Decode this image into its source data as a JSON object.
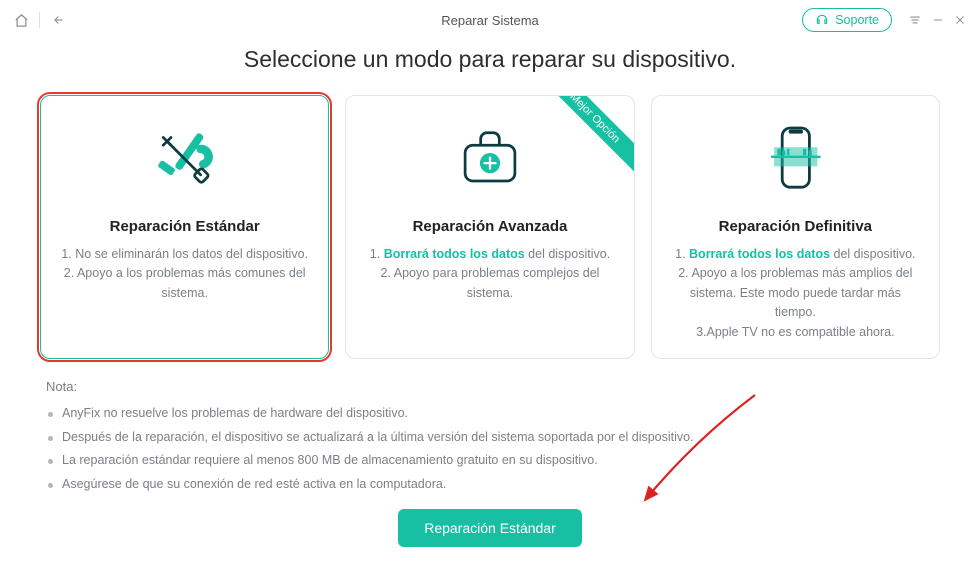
{
  "header": {
    "title": "Reparar Sistema",
    "support_label": "Soporte"
  },
  "page": {
    "heading": "Seleccione un modo para reparar su dispositivo."
  },
  "cards": [
    {
      "title": "Reparación Estándar",
      "line1_pre": "1. ",
      "line1_strong": "",
      "line1_rest": "No se eliminarán los datos del dispositivo.",
      "line2": "2. Apoyo a los problemas más comunes del sistema.",
      "line3": "",
      "ribbon": ""
    },
    {
      "title": "Reparación Avanzada",
      "line1_pre": "1. ",
      "line1_strong": "Borrará todos los datos",
      "line1_rest": " del dispositivo.",
      "line2": "2. Apoyo para problemas complejos del sistema.",
      "line3": "",
      "ribbon": "Mejor Opción"
    },
    {
      "title": "Reparación Definitiva",
      "line1_pre": "1. ",
      "line1_strong": "Borrará todos los datos",
      "line1_rest": " del dispositivo.",
      "line2": "2. Apoyo a los problemas más amplios del sistema. Este modo puede tardar más tiempo.",
      "line3": "3.Apple TV no es compatible ahora.",
      "ribbon": ""
    }
  ],
  "notes": {
    "title": "Nota:",
    "items": [
      "AnyFix no resuelve los problemas de hardware del dispositivo.",
      "Después de la reparación, el dispositivo se actualizará a la última versión del sistema soportada por el dispositivo.",
      "La reparación estándar requiere al menos 800 MB de almacenamiento gratuito en su dispositivo.",
      "Asegúrese de que su conexión de red esté activa en la computadora."
    ]
  },
  "action": {
    "label": "Reparación Estándar"
  }
}
